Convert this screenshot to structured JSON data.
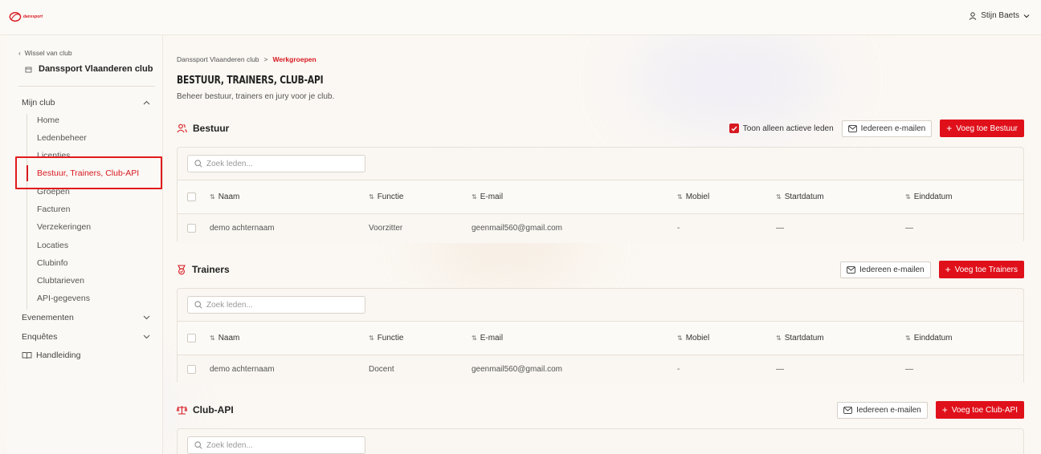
{
  "topbar": {
    "logo_text": "danssport",
    "user_name": "Stijn Baets"
  },
  "sidebar": {
    "switch_club": "Wissel van club",
    "club_name": "Danssport Vlaanderen club",
    "group_mijn_club": "Mijn club",
    "items": [
      "Home",
      "Ledenbeheer",
      "Licenties",
      "Bestuur, Trainers, Club-API",
      "Groepen",
      "Facturen",
      "Verzekeringen",
      "Locaties",
      "Clubinfo",
      "Clubtarieven",
      "API-gegevens"
    ],
    "group_evenementen": "Evenementen",
    "group_enquetes": "Enquêtes",
    "handleiding": "Handleiding"
  },
  "breadcrumb": {
    "parent": "Danssport Vlaanderen club",
    "separator": ">",
    "current": "Werkgroepen"
  },
  "page": {
    "title": "BESTUUR, TRAINERS, CLUB-API",
    "subtitle": "Beheer bestuur, trainers en jury voor je club."
  },
  "common": {
    "search_placeholder": "Zoek leden...",
    "email_all": "Iedereen e-mailen",
    "only_active": "Toon alleen actieve leden",
    "columns": [
      "Naam",
      "Functie",
      "E-mail",
      "Mobiel",
      "Startdatum",
      "Einddatum"
    ]
  },
  "sections": {
    "bestuur": {
      "title": "Bestuur",
      "add_label": "Voeg toe Bestuur",
      "rows": [
        [
          "demo achternaam",
          "Voorzitter",
          "geenmail560@gmail.com",
          "-",
          "—",
          "—"
        ]
      ]
    },
    "trainers": {
      "title": "Trainers",
      "add_label": "Voeg toe Trainers",
      "rows": [
        [
          "demo achternaam",
          "Docent",
          "geenmail560@gmail.com",
          "-",
          "—",
          "—"
        ]
      ]
    },
    "clubapi": {
      "title": "Club-API",
      "add_label": "Voeg toe Club-API"
    }
  },
  "colors": {
    "accent": "#e0101a",
    "highlight_border": "#e11b1b"
  }
}
